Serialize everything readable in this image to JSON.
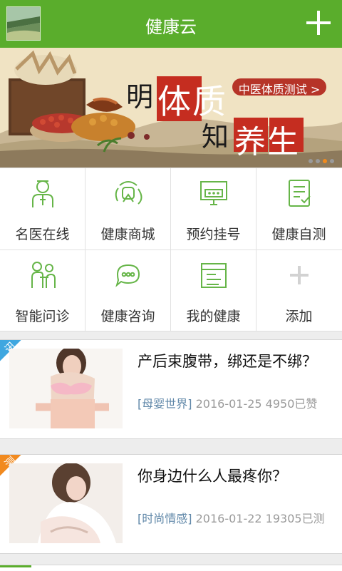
{
  "header": {
    "title": "健康云",
    "add_icon": "plus-icon"
  },
  "banner": {
    "headline_1": "明",
    "headline_2": "体质",
    "headline_3": "知",
    "headline_4": "养生",
    "button_label": "中医体质测试 >",
    "carousel_active_index": 3,
    "carousel_count": 4
  },
  "grid": [
    {
      "label": "名医在线",
      "icon": "doctor-icon"
    },
    {
      "label": "健康商城",
      "icon": "mall-icon"
    },
    {
      "label": "预约挂号",
      "icon": "appointment-icon"
    },
    {
      "label": "健康自测",
      "icon": "self-test-icon"
    },
    {
      "label": "智能问诊",
      "icon": "consultation-icon"
    },
    {
      "label": "健康咨询",
      "icon": "chat-icon"
    },
    {
      "label": "我的健康",
      "icon": "health-record-icon"
    },
    {
      "label": "添加",
      "icon": "add-icon"
    }
  ],
  "articles": [
    {
      "badge": "讯",
      "badge_color": "#3fa7e0",
      "title": "产后束腹带，绑还是不绑？",
      "category": "[母婴世界]",
      "date": "2016-01-25",
      "stats": "4950已赞"
    },
    {
      "badge": "测",
      "badge_color": "#f18a1f",
      "title": "你身边什么人最疼你？",
      "category": "[时尚情感]",
      "date": "2016-01-22",
      "stats": "19305已测"
    }
  ],
  "colors": {
    "accent": "#5aad2c",
    "icon_green": "#66b548"
  }
}
